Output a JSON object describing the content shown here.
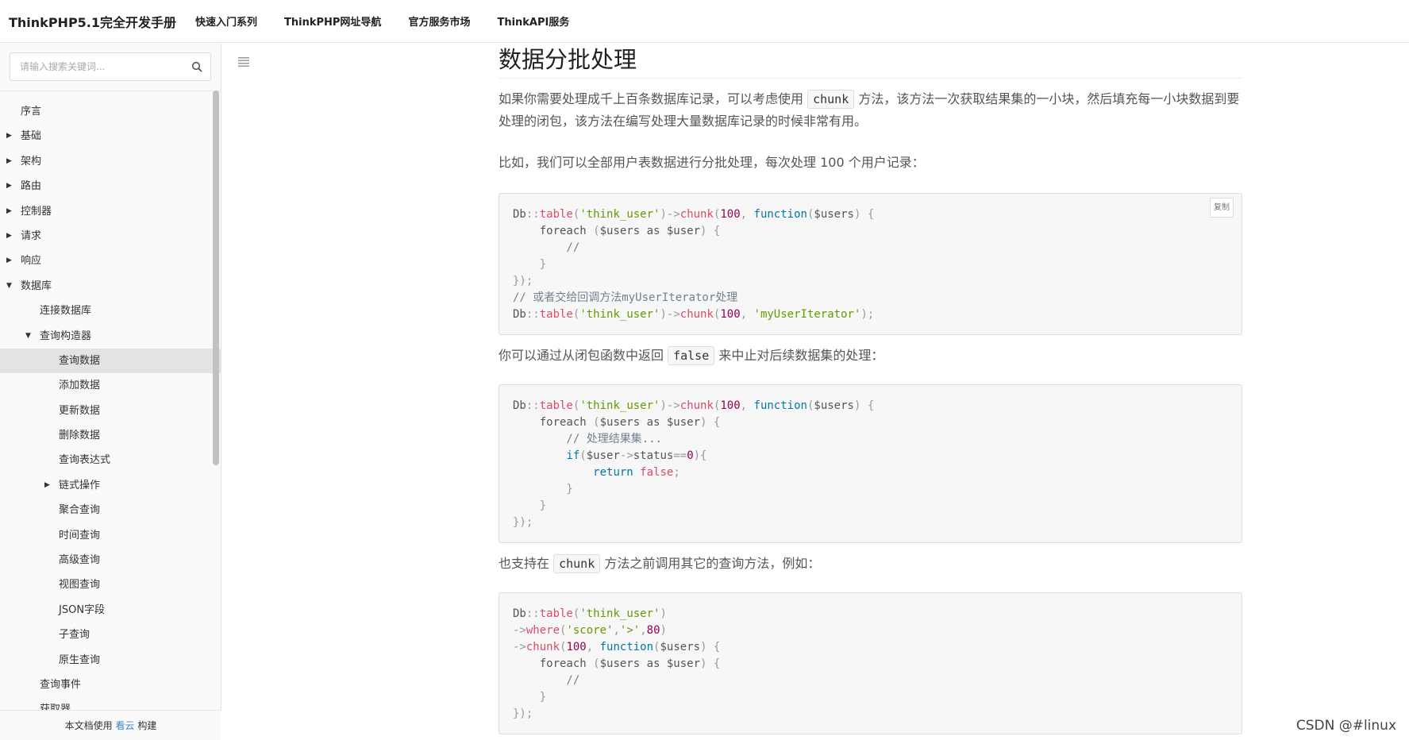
{
  "header": {
    "brand": "ThinkPHP5.1完全开发手册",
    "nav": [
      "快速入门系列",
      "ThinkPHP网址导航",
      "官方服务市场",
      "ThinkAPI服务"
    ]
  },
  "sidebar": {
    "search_placeholder": "请输入搜索关键词...",
    "items": [
      {
        "label": "序言",
        "level": 0,
        "caret": ""
      },
      {
        "label": "基础",
        "level": 0,
        "caret": "right"
      },
      {
        "label": "架构",
        "level": 0,
        "caret": "right"
      },
      {
        "label": "路由",
        "level": 0,
        "caret": "right"
      },
      {
        "label": "控制器",
        "level": 0,
        "caret": "right"
      },
      {
        "label": "请求",
        "level": 0,
        "caret": "right"
      },
      {
        "label": "响应",
        "level": 0,
        "caret": "right"
      },
      {
        "label": "数据库",
        "level": 0,
        "caret": "down"
      },
      {
        "label": "连接数据库",
        "level": 1,
        "caret": ""
      },
      {
        "label": "查询构造器",
        "level": 1,
        "caret": "down"
      },
      {
        "label": "查询数据",
        "level": 2,
        "caret": "",
        "active": true
      },
      {
        "label": "添加数据",
        "level": 2,
        "caret": ""
      },
      {
        "label": "更新数据",
        "level": 2,
        "caret": ""
      },
      {
        "label": "删除数据",
        "level": 2,
        "caret": ""
      },
      {
        "label": "查询表达式",
        "level": 2,
        "caret": ""
      },
      {
        "label": "链式操作",
        "level": 2,
        "caret": "right"
      },
      {
        "label": "聚合查询",
        "level": 2,
        "caret": ""
      },
      {
        "label": "时间查询",
        "level": 2,
        "caret": ""
      },
      {
        "label": "高级查询",
        "level": 2,
        "caret": ""
      },
      {
        "label": "视图查询",
        "level": 2,
        "caret": ""
      },
      {
        "label": "JSON字段",
        "level": 2,
        "caret": ""
      },
      {
        "label": "子查询",
        "level": 2,
        "caret": ""
      },
      {
        "label": "原生查询",
        "level": 2,
        "caret": ""
      },
      {
        "label": "查询事件",
        "level": 1,
        "caret": ""
      },
      {
        "label": "获取器",
        "level": 1,
        "caret": ""
      }
    ],
    "footer_prefix": "本文档使用 ",
    "footer_link": "看云",
    "footer_suffix": " 构建"
  },
  "content": {
    "title": "数据分批处理",
    "p1_a": "如果你需要处理成千上百条数据库记录，可以考虑使用 ",
    "p1_code": "chunk",
    "p1_b": " 方法，该方法一次获取结果集的一小块，然后填充每一小块数据到要处理的闭包，该方法在编写处理大量数据库记录的时候非常有用。",
    "p2": "比如，我们可以全部用户表数据进行分批处理，每次处理 100 个用户记录：",
    "copy_label": "复制",
    "p3_a": "你可以通过从闭包函数中返回 ",
    "p3_code": "false",
    "p3_b": " 来中止对后续数据集的处理：",
    "p4_a": "也支持在 ",
    "p4_code": "chunk",
    "p4_b": " 方法之前调用其它的查询方法，例如："
  },
  "code_blocks": [
    [
      [
        [
          "Db",
          ""
        ],
        [
          "::",
          "p"
        ],
        [
          "table",
          "f"
        ],
        [
          "(",
          "p"
        ],
        [
          "'think_user'",
          "s"
        ],
        [
          ")->",
          "p"
        ],
        [
          "chunk",
          "f"
        ],
        [
          "(",
          "p"
        ],
        [
          "100",
          "n"
        ],
        [
          ", ",
          "p"
        ],
        [
          "function",
          "k"
        ],
        [
          "(",
          "p"
        ],
        [
          "$users",
          ""
        ],
        [
          ") {",
          "p"
        ]
      ],
      [
        [
          "    foreach ",
          ""
        ],
        [
          "(",
          "p"
        ],
        [
          "$users as $user",
          ""
        ],
        [
          ") {",
          "p"
        ]
      ],
      [
        [
          "        //",
          "c"
        ]
      ],
      [
        [
          "    }",
          "p"
        ]
      ],
      [
        [
          "});",
          "p"
        ]
      ],
      [
        [
          "// 或者交给回调方法myUserIterator处理",
          "c"
        ]
      ],
      [
        [
          "Db",
          ""
        ],
        [
          "::",
          "p"
        ],
        [
          "table",
          "f"
        ],
        [
          "(",
          "p"
        ],
        [
          "'think_user'",
          "s"
        ],
        [
          ")->",
          "p"
        ],
        [
          "chunk",
          "f"
        ],
        [
          "(",
          "p"
        ],
        [
          "100",
          "n"
        ],
        [
          ", ",
          "p"
        ],
        [
          "'myUserIterator'",
          "s"
        ],
        [
          ");",
          "p"
        ]
      ]
    ],
    [
      [
        [
          "Db",
          ""
        ],
        [
          "::",
          "p"
        ],
        [
          "table",
          "f"
        ],
        [
          "(",
          "p"
        ],
        [
          "'think_user'",
          "s"
        ],
        [
          ")->",
          "p"
        ],
        [
          "chunk",
          "f"
        ],
        [
          "(",
          "p"
        ],
        [
          "100",
          "n"
        ],
        [
          ", ",
          "p"
        ],
        [
          "function",
          "k"
        ],
        [
          "(",
          "p"
        ],
        [
          "$users",
          ""
        ],
        [
          ") {",
          "p"
        ]
      ],
      [
        [
          "    foreach ",
          ""
        ],
        [
          "(",
          "p"
        ],
        [
          "$users as $user",
          ""
        ],
        [
          ") {",
          "p"
        ]
      ],
      [
        [
          "        // 处理结果集...",
          "c"
        ]
      ],
      [
        [
          "        ",
          ""
        ],
        [
          "if",
          "k"
        ],
        [
          "(",
          "p"
        ],
        [
          "$user",
          ""
        ],
        [
          "->",
          "p"
        ],
        [
          "status",
          ""
        ],
        [
          "==",
          "p"
        ],
        [
          "0",
          "n"
        ],
        [
          "){",
          "p"
        ]
      ],
      [
        [
          "            ",
          ""
        ],
        [
          "return",
          "k"
        ],
        [
          " ",
          ""
        ],
        [
          "false",
          "f"
        ],
        [
          ";",
          "p"
        ]
      ],
      [
        [
          "        }",
          "p"
        ]
      ],
      [
        [
          "    }",
          "p"
        ]
      ],
      [
        [
          "});",
          "p"
        ]
      ]
    ],
    [
      [
        [
          "Db",
          ""
        ],
        [
          "::",
          "p"
        ],
        [
          "table",
          "f"
        ],
        [
          "(",
          "p"
        ],
        [
          "'think_user'",
          "s"
        ],
        [
          ")",
          "p"
        ]
      ],
      [
        [
          "->",
          "p"
        ],
        [
          "where",
          "f"
        ],
        [
          "(",
          "p"
        ],
        [
          "'score'",
          "s"
        ],
        [
          ",",
          "p"
        ],
        [
          "'>'",
          "s"
        ],
        [
          ",",
          "p"
        ],
        [
          "80",
          "n"
        ],
        [
          ")",
          "p"
        ]
      ],
      [
        [
          "->",
          "p"
        ],
        [
          "chunk",
          "f"
        ],
        [
          "(",
          "p"
        ],
        [
          "100",
          "n"
        ],
        [
          ", ",
          "p"
        ],
        [
          "function",
          "k"
        ],
        [
          "(",
          "p"
        ],
        [
          "$users",
          ""
        ],
        [
          ") {",
          "p"
        ]
      ],
      [
        [
          "    foreach ",
          ""
        ],
        [
          "(",
          "p"
        ],
        [
          "$users as $user",
          ""
        ],
        [
          ") {",
          "p"
        ]
      ],
      [
        [
          "        //",
          "c"
        ]
      ],
      [
        [
          "    }",
          "p"
        ]
      ],
      [
        [
          "});",
          "p"
        ]
      ]
    ]
  ],
  "watermark": "CSDN @#linux"
}
